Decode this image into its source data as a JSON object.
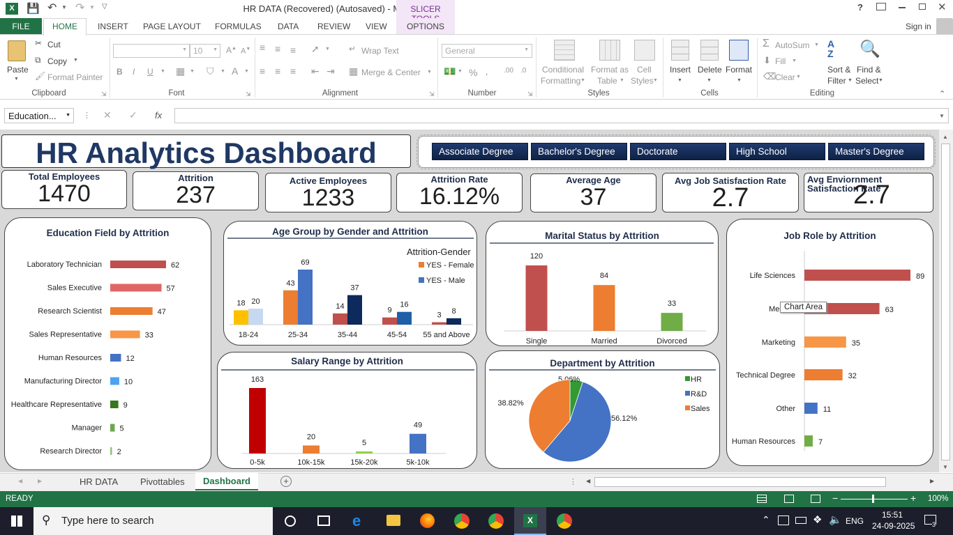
{
  "window": {
    "title": "HR DATA (Recovered) (Autosaved) - Microsoft Excel",
    "context_tab": "SLICER TOOLS",
    "help": "?",
    "sign_in": "Sign in"
  },
  "ribbon_tabs": [
    "FILE",
    "HOME",
    "INSERT",
    "PAGE LAYOUT",
    "FORMULAS",
    "DATA",
    "REVIEW",
    "VIEW",
    "OPTIONS"
  ],
  "ribbon": {
    "clipboard": {
      "paste": "Paste",
      "cut": "Cut",
      "copy": "Copy",
      "format_painter": "Format Painter",
      "label": "Clipboard"
    },
    "font": {
      "size": "10",
      "bold": "B",
      "italic": "I",
      "underline": "U",
      "label": "Font"
    },
    "alignment": {
      "wrap": "Wrap Text",
      "merge": "Merge & Center",
      "label": "Alignment"
    },
    "number": {
      "format": "General",
      "percent": "%",
      "label": "Number"
    },
    "styles": {
      "conditional": "Conditional",
      "conditional2": "Formatting",
      "format_table": "Format as",
      "format_table2": "Table",
      "cell_styles": "Cell",
      "cell_styles2": "Styles",
      "label": "Styles"
    },
    "cells": {
      "insert": "Insert",
      "delete": "Delete",
      "format": "Format",
      "label": "Cells"
    },
    "editing": {
      "autosum": "AutoSum",
      "fill": "Fill",
      "clear": "Clear",
      "sort": "Sort &",
      "sort2": "Filter",
      "find": "Find &",
      "find2": "Select",
      "label": "Editing"
    }
  },
  "formula_bar": {
    "name_box": "Education...",
    "fx": "fx",
    "value": ""
  },
  "dashboard": {
    "title": "HR Analytics Dashboard",
    "slicer": [
      "Associate Degree",
      "Bachelor's Degree",
      "Doctorate",
      "High School",
      "Master's Degree"
    ],
    "kpis": [
      {
        "label": "Total Employees",
        "value": "1470"
      },
      {
        "label": "Attrition",
        "value": "237"
      },
      {
        "label": "Active Employees",
        "value": "1233"
      },
      {
        "label": "Attrition Rate",
        "value": "16.12%"
      },
      {
        "label": "Average Age",
        "value": "37"
      },
      {
        "label": "Avg Job Satisfaction Rate",
        "value": "2.7"
      },
      {
        "label": "Avg Enviornment Satisfaction Rate",
        "value": "2.7"
      }
    ],
    "tooltip": "Chart Area"
  },
  "chart_data": [
    {
      "type": "bar",
      "title": "Education Field by Attrition",
      "categories": [
        "Laboratory Technician",
        "Sales Executive",
        "Research Scientist",
        "Sales Representative",
        "Human Resources",
        "Manufacturing Director",
        "Healthcare Representative",
        "Manager",
        "Research Director"
      ],
      "values": [
        62,
        57,
        47,
        33,
        12,
        10,
        9,
        5,
        2
      ],
      "colors": [
        "#c0504d",
        "#e06666",
        "#ed7d31",
        "#f79646",
        "#4472c4",
        "#4da3f0",
        "#38761d",
        "#6aa84f",
        "#93c47d"
      ]
    },
    {
      "type": "bar",
      "title": "Age Group by Gender and Attrition",
      "categories": [
        "18-24",
        "25-34",
        "35-44",
        "45-54",
        "55 and Above"
      ],
      "legend_title": "Attrition-Gender",
      "series": [
        {
          "name": "YES - Female",
          "values": [
            18,
            43,
            14,
            9,
            3
          ]
        },
        {
          "name": "YES - Male",
          "values": [
            20,
            69,
            37,
            16,
            8
          ]
        }
      ],
      "female_colors": [
        "#ffc000",
        "#ed7d31",
        "#c0504d",
        "#c0504d",
        "#c0504d"
      ],
      "male_colors": [
        "#c6d9f1",
        "#4472c4",
        "#0d2a5c",
        "#1f5fa8",
        "#0d2a5c"
      ],
      "legend_colors": [
        "#ed7d31",
        "#4472c4"
      ]
    },
    {
      "type": "bar",
      "title": "Marital Status by Attrition",
      "categories": [
        "Single",
        "Married",
        "Divorced"
      ],
      "values": [
        120,
        84,
        33
      ],
      "colors": [
        "#c0504d",
        "#ed7d31",
        "#70ad47"
      ]
    },
    {
      "type": "bar",
      "title": "Job Role by Attrition",
      "categories": [
        "Life Sciences",
        "Medical",
        "Marketing",
        "Technical Degree",
        "Other",
        "Human Resources"
      ],
      "values": [
        89,
        63,
        35,
        32,
        11,
        7
      ],
      "colors": [
        "#c0504d",
        "#c0504d",
        "#f79646",
        "#ed7d31",
        "#4472c4",
        "#70ad47"
      ]
    },
    {
      "type": "bar",
      "title": "Salary Range by Attrition",
      "categories": [
        "0-5k",
        "10k-15k",
        "15k-20k",
        "5k-10k"
      ],
      "values": [
        163,
        20,
        5,
        49
      ],
      "colors": [
        "#c00000",
        "#ed7d31",
        "#92d050",
        "#4472c4"
      ]
    },
    {
      "type": "pie",
      "title": "Department by Attrition",
      "categories": [
        "HR",
        "R&D",
        "Sales"
      ],
      "values": [
        5.06,
        56.12,
        38.82
      ],
      "labels": [
        "5.06%",
        "56.12%",
        "38.82%"
      ],
      "colors": [
        "#339933",
        "#4472c4",
        "#ed7d31"
      ]
    }
  ],
  "sheet_tabs": [
    "HR  DATA",
    "Pivottables",
    "Dashboard"
  ],
  "status": {
    "ready": "READY",
    "zoom": "100%"
  },
  "taskbar": {
    "search": "Type here to search",
    "lang": "ENG",
    "time": "15:51",
    "date": "24-09-2025",
    "notif": "3"
  }
}
